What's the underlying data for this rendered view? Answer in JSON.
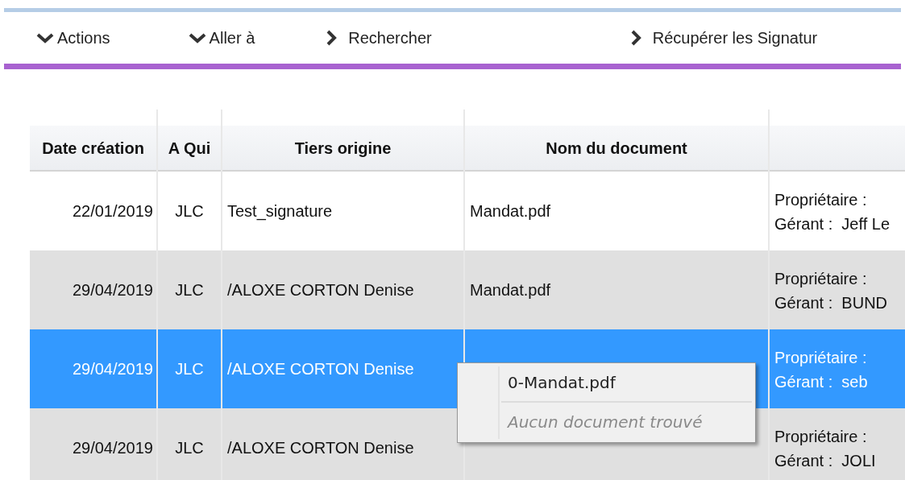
{
  "toolbar": [
    {
      "label": "Actions",
      "kind": "dropdown"
    },
    {
      "label": "Aller à",
      "kind": "dropdown"
    },
    {
      "label": "Rechercher",
      "kind": "link"
    },
    {
      "label": "Récupérer les Signatur",
      "kind": "link"
    }
  ],
  "table": {
    "columns": [
      "Date création",
      "A Qui",
      "Tiers origine",
      "Nom du document"
    ],
    "rows": [
      {
        "selected": false,
        "cells": [
          "22/01/2019",
          "JLC",
          "Test_signature",
          "Mandat.pdf"
        ],
        "people": [
          "Propriétaire :",
          "Gérant :  Jeff Le"
        ]
      },
      {
        "selected": false,
        "cells": [
          "29/04/2019",
          "JLC",
          "/ALOXE CORTON Denise",
          "Mandat.pdf"
        ],
        "people": [
          "Propriétaire :",
          "Gérant :  BUND"
        ]
      },
      {
        "selected": true,
        "cells": [
          "29/04/2019",
          "JLC",
          "/ALOXE CORTON Denise"
        ],
        "people": [
          "Propriétaire :",
          "Gérant :  seb"
        ]
      },
      {
        "selected": false,
        "cells": [
          "29/04/2019",
          "JLC",
          "/ALOXE CORTON Denise"
        ],
        "people": [
          "Propriétaire :",
          "Gérant :  JOLI"
        ]
      }
    ]
  },
  "context_menu": {
    "items": [
      {
        "label": "0-Mandat.pdf",
        "disabled": false
      },
      {
        "label": "Aucun document trouvé",
        "disabled": true
      }
    ]
  }
}
